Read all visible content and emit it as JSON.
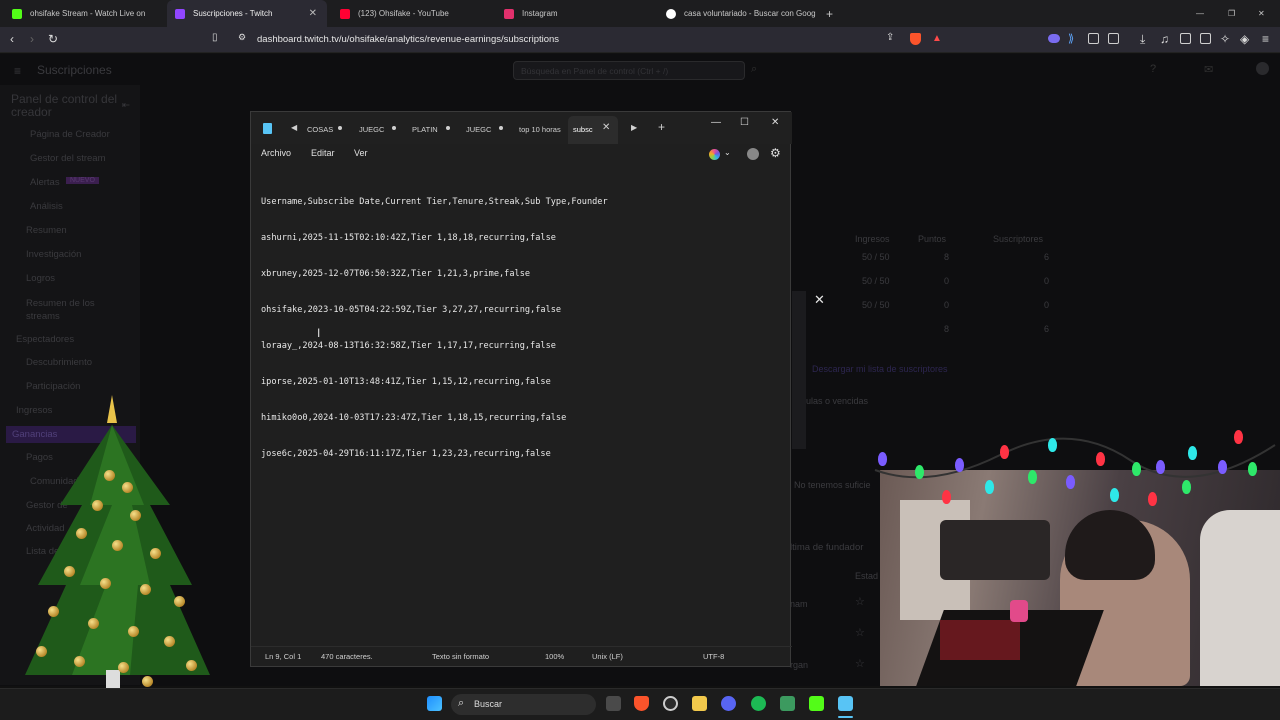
{
  "browser": {
    "tabs": [
      {
        "label": "ohsifake Stream - Watch Live on",
        "color": "#53fc18"
      },
      {
        "label": "Suscripciones - Twitch",
        "color": "#9146ff"
      },
      {
        "label": "(123) Ohsifake - YouTube",
        "color": "#ff0033"
      },
      {
        "label": "Instagram",
        "color": "#e1306c"
      },
      {
        "label": "casa voluntariado - Buscar con Goog",
        "color": "#ffffff"
      }
    ],
    "url": "dashboard.twitch.tv/u/ohsifake/analytics/revenue-earnings/subscriptions"
  },
  "twitch": {
    "header_title": "Suscripciones",
    "search_placeholder": "Búsqueda en Panel de control (Ctrl + /)",
    "panel_title": "Panel de control del creador",
    "nav": [
      "Página de Creador",
      "Gestor del stream",
      "Alertas",
      "Análisis",
      "Resumen",
      "Investigación",
      "Logros",
      "Resumen de los streams",
      "Espectadores",
      "Descubrimiento",
      "Participación",
      "Ingresos",
      "Ganancias",
      "Pagos",
      "Comunidad",
      "Gestor de",
      "Actividad",
      "Lista de"
    ],
    "alerts_badge": "NUEVO",
    "table_headers": [
      "Ingresos",
      "Puntos",
      "Suscriptores"
    ],
    "table_rows": [
      [
        "50 / 50",
        "8",
        "6"
      ],
      [
        "50 / 50",
        "0",
        "0"
      ],
      [
        "50 / 50",
        "0",
        "0"
      ],
      [
        "",
        "8",
        "6"
      ]
    ],
    "download_link": "Descargar mi lista de suscriptores",
    "expired_text": "ulas o vencidas",
    "insufficient_text": "No tenemos suficie",
    "founder_heading": "ltima de fundador",
    "state_header": "Estad",
    "row_names": [
      "nam",
      "",
      "rgan"
    ]
  },
  "notepad": {
    "tabs": [
      "COSAS",
      "JUEGC",
      "PLATIN",
      "JUEGC",
      "top 10 horas",
      "subsc"
    ],
    "menu": [
      "Archivo",
      "Editar",
      "Ver"
    ],
    "lines": [
      "Username,Subscribe Date,Current Tier,Tenure,Streak,Sub Type,Founder",
      "ashurni,2025-11-15T02:10:42Z,Tier 1,18,18,recurring,false",
      "xbruney,2025-12-07T06:50:32Z,Tier 1,21,3,prime,false",
      "ohsifake,2023-10-05T04:22:59Z,Tier 3,27,27,recurring,false",
      "loraay_,2024-08-13T16:32:58Z,Tier 1,17,17,recurring,false",
      "iporse,2025-01-10T13:48:41Z,Tier 1,15,12,recurring,false",
      "himiko0o0,2024-10-03T17:23:47Z,Tier 1,18,15,recurring,false",
      "jose6c,2025-04-29T16:11:17Z,Tier 1,23,23,recurring,false"
    ],
    "status": {
      "position": "Ln 9, Col 1",
      "chars": "470 caracteres.",
      "format": "Texto sin formato",
      "zoom": "100%",
      "eol": "Unix (LF)",
      "encoding": "UTF-8"
    }
  },
  "taskbar": {
    "search_label": "Buscar"
  }
}
